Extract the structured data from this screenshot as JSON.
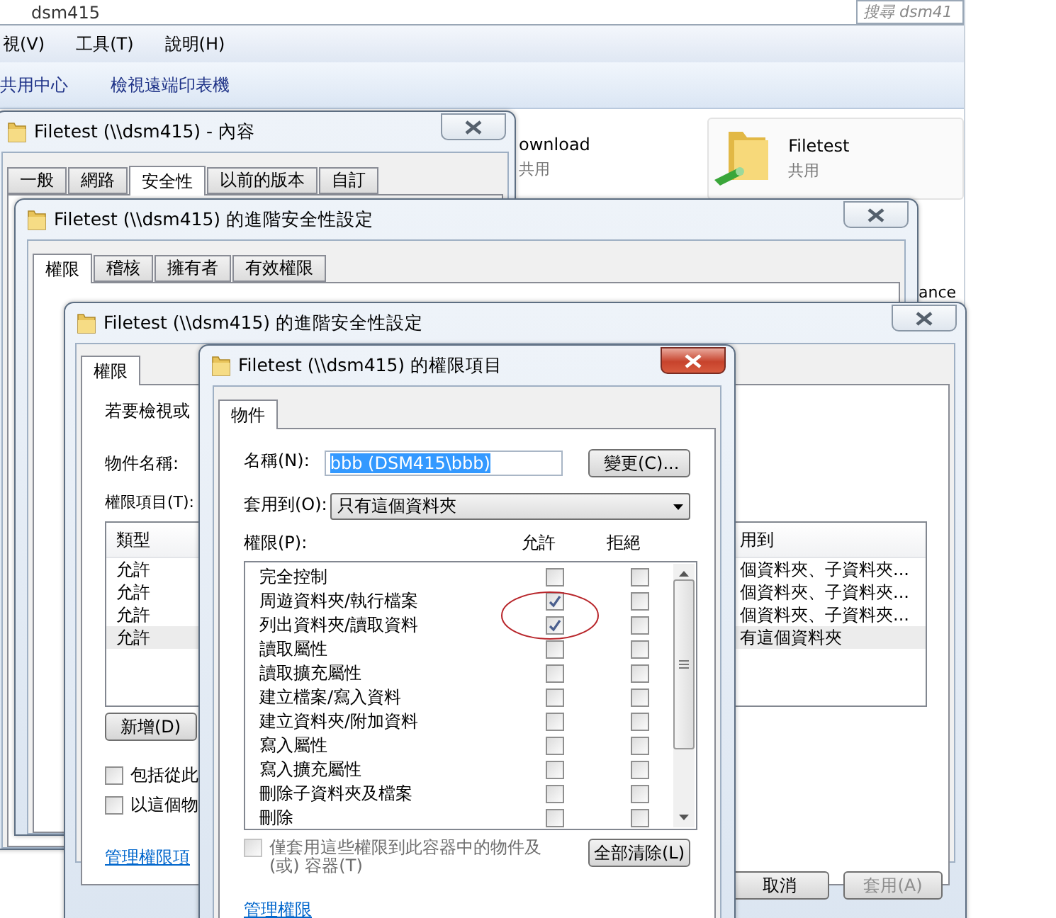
{
  "explorer": {
    "breadcrumb": "dsm415",
    "search": {
      "placeholder": "搜尋 dsm41"
    },
    "menu": [
      "視(V)",
      "工具(T)",
      "說明(H)"
    ],
    "toolbar": [
      "共用中心",
      "檢視遠端印表機"
    ],
    "items": [
      {
        "name": "ownload",
        "type": "共用"
      },
      {
        "name": "Filetest",
        "type": "共用"
      }
    ],
    "fragment": "ance"
  },
  "properties_window": {
    "title": "Filetest (\\\\dsm415) - 內容",
    "tabs": [
      {
        "label": "一般",
        "selected": false
      },
      {
        "label": "網路",
        "selected": false
      },
      {
        "label": "安全性",
        "selected": true
      },
      {
        "label": "以前的版本",
        "selected": false
      },
      {
        "label": "自訂",
        "selected": false
      }
    ]
  },
  "advanced_window_back": {
    "title": "Filetest (\\\\dsm415) 的進階安全性設定",
    "tabs": [
      {
        "label": "權限",
        "selected": true
      },
      {
        "label": "稽核",
        "selected": false
      },
      {
        "label": "擁有者",
        "selected": false
      },
      {
        "label": "有效權限",
        "selected": false
      }
    ]
  },
  "advanced_window": {
    "title": "Filetest (\\\\dsm415) 的進階安全性設定",
    "tabs": [
      {
        "label": "權限",
        "selected": true
      }
    ],
    "instruction": "若要檢視或",
    "object_name_label": "物件名稱:",
    "entries_label": "權限項目(T):",
    "columns": [
      "類型",
      "用到"
    ],
    "rows": [
      {
        "type": "允許",
        "applies_to": "個資料夾、子資料夾...",
        "selected": false
      },
      {
        "type": "允許",
        "applies_to": "個資料夾、子資料夾...",
        "selected": false
      },
      {
        "type": "允許",
        "applies_to": "個資料夾、子資料夾...",
        "selected": false
      },
      {
        "type": "允許",
        "applies_to": "有這個資料夾",
        "selected": true
      }
    ],
    "add_button": "新增(D)",
    "checkboxes": [
      {
        "label": "包括從此",
        "checked": false
      },
      {
        "label": "以這個物",
        "checked": false
      }
    ],
    "link": "管理權限項",
    "buttons": [
      {
        "label": "取消",
        "disabled": false
      },
      {
        "label": "套用(A)",
        "disabled": true
      }
    ]
  },
  "entry_window": {
    "title": "Filetest (\\\\dsm415) 的權限項目",
    "tabs": [
      {
        "label": "物件",
        "selected": true
      }
    ],
    "name_label": "名稱(N):",
    "name_value": "bbb (DSM415\\bbb)",
    "change_button": "變更(C)...",
    "apply_label": "套用到(O):",
    "apply_value": "只有這個資料夾",
    "permissions_label": "權限(P):",
    "allow_header": "允許",
    "deny_header": "拒絕",
    "permissions": [
      {
        "name": "完全控制",
        "allow": false,
        "deny": false
      },
      {
        "name": "周遊資料夾/執行檔案",
        "allow": true,
        "deny": false
      },
      {
        "name": "列出資料夾/讀取資料",
        "allow": true,
        "deny": false
      },
      {
        "name": "讀取屬性",
        "allow": false,
        "deny": false
      },
      {
        "name": "讀取擴充屬性",
        "allow": false,
        "deny": false
      },
      {
        "name": "建立檔案/寫入資料",
        "allow": false,
        "deny": false
      },
      {
        "name": "建立資料夾/附加資料",
        "allow": false,
        "deny": false
      },
      {
        "name": "寫入屬性",
        "allow": false,
        "deny": false
      },
      {
        "name": "寫入擴充屬性",
        "allow": false,
        "deny": false
      },
      {
        "name": "刪除子資料夾及檔案",
        "allow": false,
        "deny": false
      },
      {
        "name": "刪除",
        "allow": false,
        "deny": false
      }
    ],
    "container_only": {
      "label": "僅套用這些權限到此容器中的物件及 (或) 容器(T)",
      "checked": false,
      "disabled": true
    },
    "clear_button": "全部清除(L)",
    "link": "管理權限"
  }
}
